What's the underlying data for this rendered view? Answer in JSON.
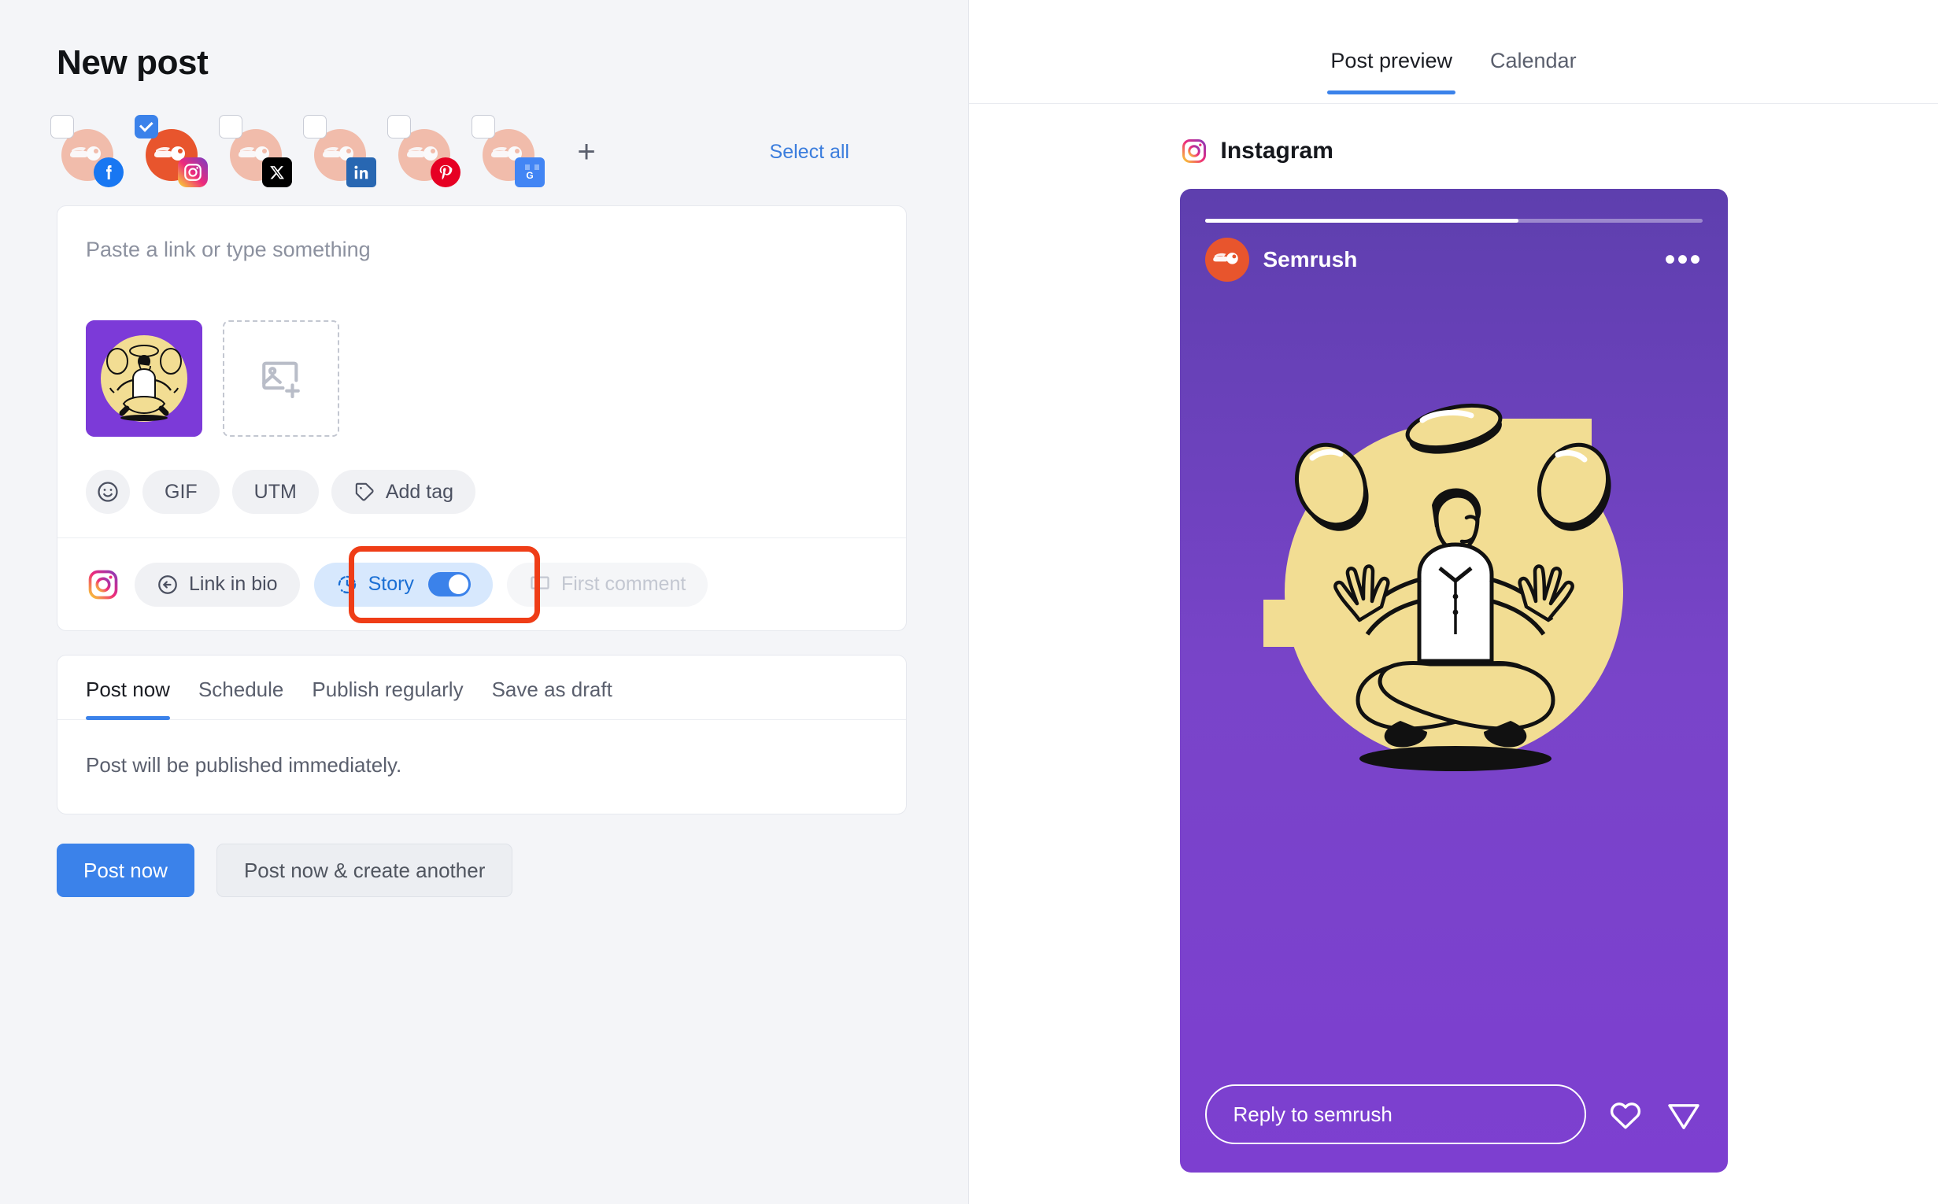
{
  "left": {
    "page_title": "New post",
    "accounts": [
      {
        "network": "facebook",
        "icon": "facebook-icon",
        "selected": false
      },
      {
        "network": "instagram",
        "icon": "instagram-icon",
        "selected": true
      },
      {
        "network": "x",
        "icon": "x-twitter-icon",
        "selected": false
      },
      {
        "network": "linkedin",
        "icon": "linkedin-icon",
        "selected": false
      },
      {
        "network": "pinterest",
        "icon": "pinterest-icon",
        "selected": false
      },
      {
        "network": "google-business",
        "icon": "google-business-icon",
        "selected": false
      }
    ],
    "add_account_label": "+",
    "select_all_label": "Select all",
    "composer": {
      "placeholder": "Paste a link or type something",
      "value": "",
      "media_count": 1,
      "chips": [
        {
          "id": "emoji",
          "label": "",
          "icon": "emoji-icon"
        },
        {
          "id": "gif",
          "label": "GIF",
          "icon": ""
        },
        {
          "id": "utm",
          "label": "UTM",
          "icon": ""
        },
        {
          "id": "tag",
          "label": "Add tag",
          "icon": "tag-icon"
        }
      ]
    },
    "social_row": {
      "network_icon": "instagram-icon",
      "link_in_bio_label": "Link in bio",
      "story_label": "Story",
      "story_enabled": true,
      "first_comment_label": "First comment",
      "first_comment_disabled": true,
      "highlight_color": "#ef3d17"
    },
    "schedule": {
      "tabs": [
        {
          "label": "Post now",
          "active": true
        },
        {
          "label": "Schedule",
          "active": false
        },
        {
          "label": "Publish regularly",
          "active": false
        },
        {
          "label": "Save as draft",
          "active": false
        }
      ],
      "note": "Post will be published immediately."
    },
    "actions": {
      "primary_label": "Post now",
      "secondary_label": "Post now & create another"
    }
  },
  "right": {
    "tabs": [
      {
        "label": "Post preview",
        "active": true
      },
      {
        "label": "Calendar",
        "active": false
      }
    ],
    "preview": {
      "network_label": "Instagram",
      "network_icon": "instagram-icon",
      "story": {
        "progress_percent": 63,
        "account_name": "Semrush",
        "menu_icon": "more-options-icon",
        "reply_placeholder": "Reply to semrush",
        "like_icon": "heart-icon",
        "share_icon": "send-icon",
        "background_colors": [
          "#5e3fae",
          "#7944c9",
          "#7d3fd0"
        ],
        "art_circle_color": "#f2dd93",
        "art_description": "meditating person juggling discs"
      }
    }
  },
  "colors": {
    "accent_blue": "#3b82ea",
    "highlight_red": "#ef3d17",
    "brand_orange": "#e8552d",
    "story_purple": "#7944c9",
    "page_bg": "#f4f5f8"
  }
}
